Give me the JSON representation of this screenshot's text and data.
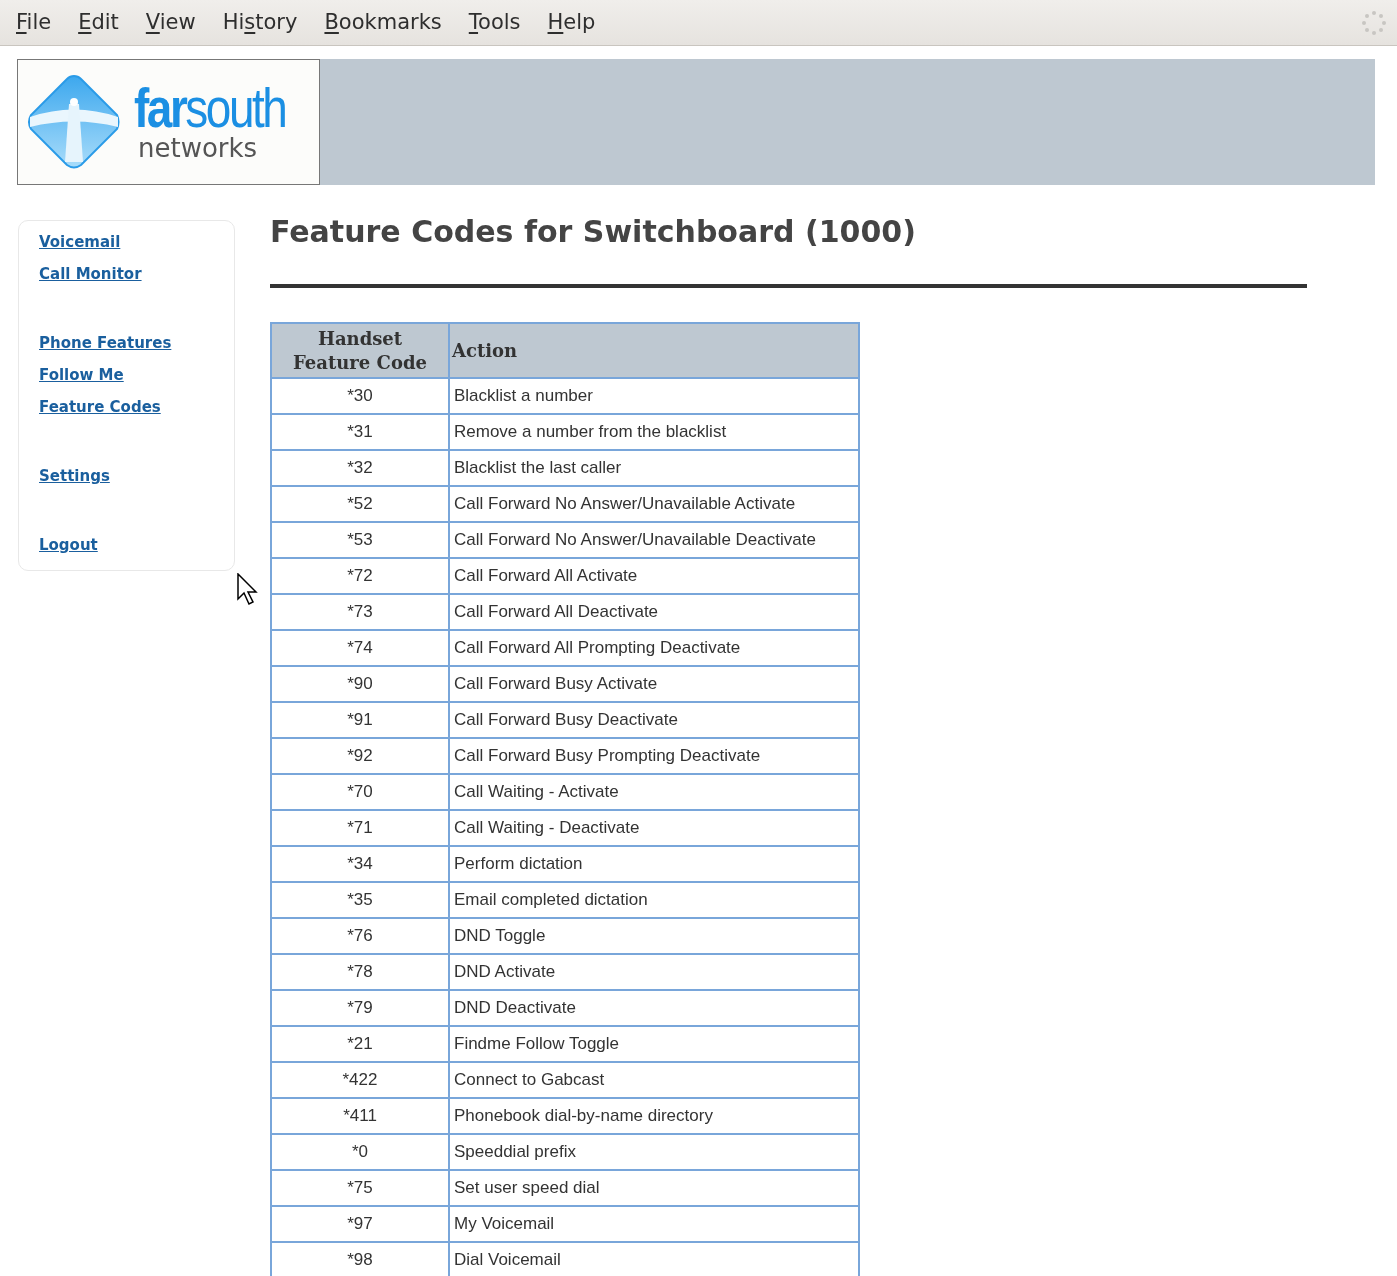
{
  "menu_bar": {
    "items": [
      {
        "access_key": "F",
        "after": "ile"
      },
      {
        "access_key": "E",
        "after": "dit"
      },
      {
        "access_key": "V",
        "after": "iew"
      },
      {
        "before": "Hi",
        "access_key": "s",
        "after": "tory"
      },
      {
        "access_key": "B",
        "after": "ookmarks"
      },
      {
        "access_key": "T",
        "after": "ools"
      },
      {
        "access_key": "H",
        "after": "elp"
      }
    ]
  },
  "logo": {
    "brand": "**far**south",
    "tagline": "networks"
  },
  "sidebar": {
    "groups": [
      [
        "Voicemail",
        "Call Monitor"
      ],
      [
        "Phone Features",
        "Follow Me",
        "Feature Codes"
      ],
      [
        "Settings"
      ],
      [
        "Logout"
      ]
    ]
  },
  "page_title": "Feature Codes for Switchboard (1000)",
  "table": {
    "columns": [
      "Handset\nFeature Code",
      "Action"
    ],
    "rows": [
      [
        "*30",
        "Blacklist a number"
      ],
      [
        "*31",
        "Remove a number from the blacklist"
      ],
      [
        "*32",
        "Blacklist the last caller"
      ],
      [
        "*52",
        "Call Forward No Answer/Unavailable Activate"
      ],
      [
        "*53",
        "Call Forward No Answer/Unavailable Deactivate"
      ],
      [
        "*72",
        "Call Forward All Activate"
      ],
      [
        "*73",
        "Call Forward All Deactivate"
      ],
      [
        "*74",
        "Call Forward All Prompting Deactivate"
      ],
      [
        "*90",
        "Call Forward Busy Activate"
      ],
      [
        "*91",
        "Call Forward Busy Deactivate"
      ],
      [
        "*92",
        "Call Forward Busy Prompting Deactivate"
      ],
      [
        "*70",
        "Call Waiting - Activate"
      ],
      [
        "*71",
        "Call Waiting - Deactivate"
      ],
      [
        "*34",
        "Perform dictation"
      ],
      [
        "*35",
        "Email completed dictation"
      ],
      [
        "*76",
        "DND Toggle"
      ],
      [
        "*78",
        "DND Activate"
      ],
      [
        "*79",
        "DND Deactivate"
      ],
      [
        "*21",
        "Findme Follow Toggle"
      ],
      [
        "*422",
        "Connect to Gabcast"
      ],
      [
        "*411",
        "Phonebook dial-by-name directory"
      ],
      [
        "*0",
        "Speeddial prefix"
      ],
      [
        "*75",
        "Set user speed dial"
      ],
      [
        "*97",
        "My Voicemail"
      ],
      [
        "*98",
        "Dial Voicemail"
      ]
    ]
  }
}
